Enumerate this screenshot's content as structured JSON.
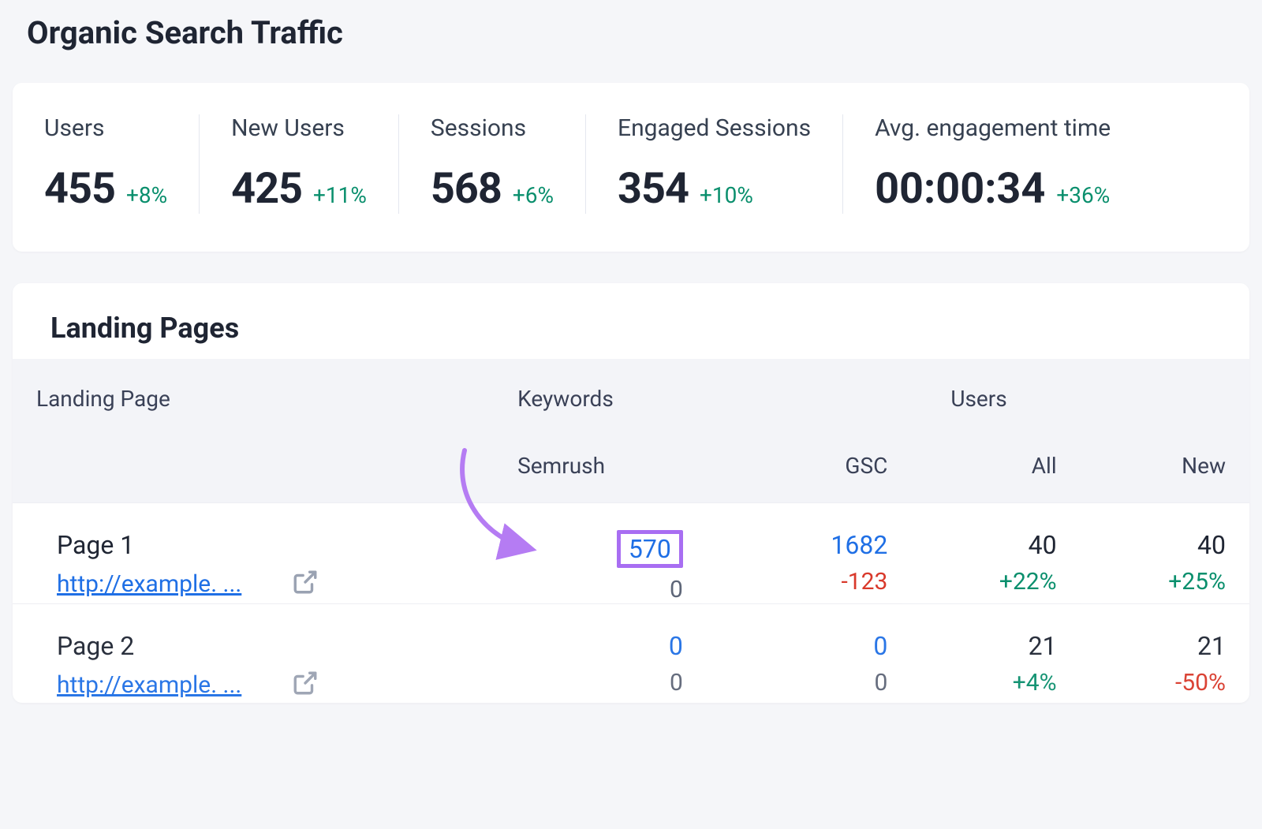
{
  "title": "Organic Search Traffic",
  "stats": [
    {
      "id": "users",
      "label": "Users",
      "value": "455",
      "delta": "+8%"
    },
    {
      "id": "newusers",
      "label": "New Users",
      "value": "425",
      "delta": "+11%"
    },
    {
      "id": "sessions",
      "label": "Sessions",
      "value": "568",
      "delta": "+6%"
    },
    {
      "id": "engaged",
      "label": "Engaged Sessions",
      "value": "354",
      "delta": "+10%"
    },
    {
      "id": "avgeng",
      "label": "Avg. engagement time",
      "value": "00:00:34",
      "delta": "+36%"
    }
  ],
  "landing": {
    "section_title": "Landing Pages",
    "headers": {
      "page": "Landing Page",
      "keywords_group": "Keywords",
      "users_group": "Users",
      "semrush": "Semrush",
      "gsc": "GSC",
      "all": "All",
      "new": "New"
    },
    "rows": [
      {
        "name": "Page 1",
        "url": "http://example. ...",
        "semrush": {
          "value": "570",
          "sub": "0"
        },
        "gsc": {
          "value": "1682",
          "sub": "-123",
          "sub_sign": "neg"
        },
        "all": {
          "value": "40",
          "sub": "+22%",
          "sub_sign": "pos"
        },
        "new": {
          "value": "40",
          "sub": "+25%",
          "sub_sign": "pos"
        }
      },
      {
        "name": "Page 2",
        "url": "http://example. ...",
        "semrush": {
          "value": "0",
          "sub": "0"
        },
        "gsc": {
          "value": "0",
          "sub": "0"
        },
        "all": {
          "value": "21",
          "sub": "+4%",
          "sub_sign": "pos"
        },
        "new": {
          "value": "21",
          "sub": "-50%",
          "sub_sign": "neg"
        }
      }
    ]
  }
}
